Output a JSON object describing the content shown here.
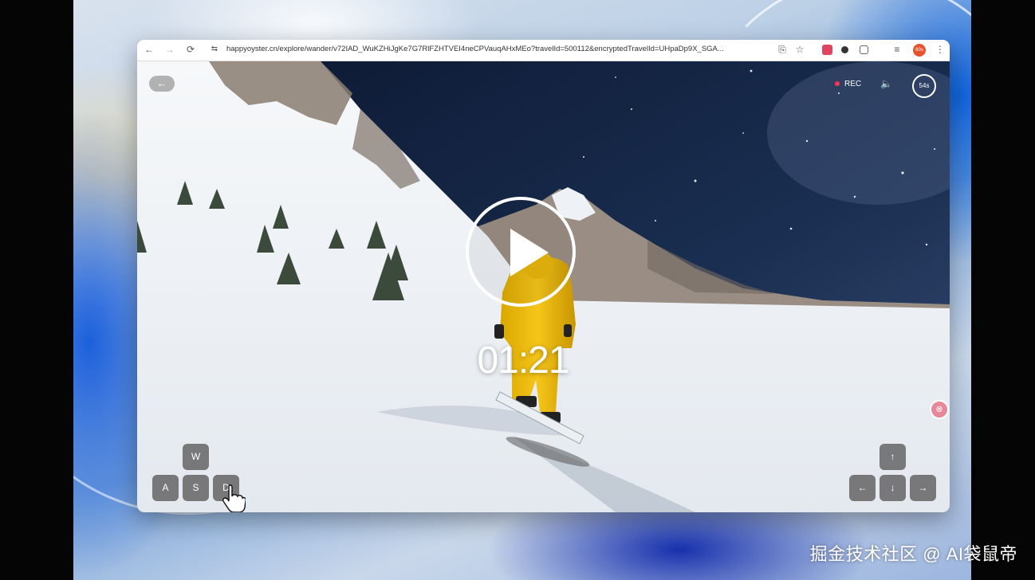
{
  "browser": {
    "nav": {
      "back_icon": "←",
      "forward_icon": "→",
      "reload_icon": "⟳",
      "site_info_icon": "⇆"
    },
    "url": "happyoyster.cn/explore/wander/v72IAD_WuKZHiJgKe7G7RlFZHTVEI4neCPVauqAHxMEo?travelId=500112&encryptedTravelId=UHpaDp9X_SGA...",
    "right_icons": {
      "translate": "⎘",
      "bookmark": "☆",
      "menu": "⋮",
      "tabsearch": "≡"
    },
    "ext_colors": [
      "#e0455f",
      "#333333",
      "#666666",
      "#e8532e"
    ],
    "avatar_label": "60s"
  },
  "player": {
    "back_label": "←",
    "rec_label": "REC",
    "volume_icon": "🔈",
    "countdown": "54s",
    "time": "01:21",
    "keys": {
      "w": "W",
      "a": "A",
      "s": "S",
      "d": "D"
    },
    "arrows": {
      "up": "↑",
      "left": "←",
      "down": "↓",
      "right": "→"
    },
    "side_badge": "⊗"
  },
  "watermark": "掘金技术社区 @ AI袋鼠帝"
}
